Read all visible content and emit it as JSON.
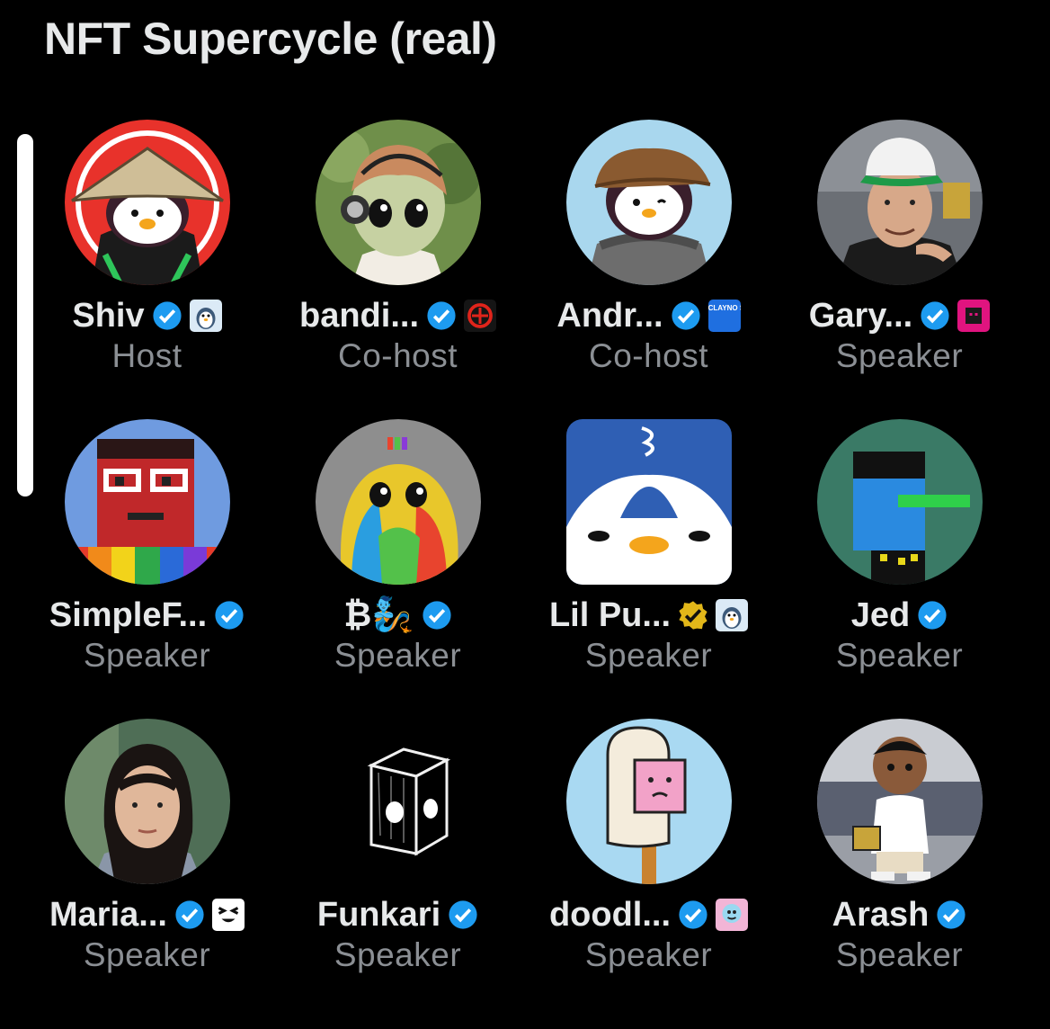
{
  "space": {
    "title": "NFT Supercycle (real)"
  },
  "participants": [
    {
      "name": "Shiv",
      "role": "Host",
      "verified": "blue",
      "affiliation": "pudgy-penguin-badge"
    },
    {
      "name": "bandi...",
      "role": "Co-host",
      "verified": "blue",
      "affiliation": "red-emblem-badge"
    },
    {
      "name": "Andr...",
      "role": "Co-host",
      "verified": "blue",
      "affiliation": "claynosaurz-badge",
      "affiliation_text": "CLAYNO SAURZ"
    },
    {
      "name": "Gary...",
      "role": "Speaker",
      "verified": "blue",
      "affiliation": "magenta-cube-badge"
    },
    {
      "name": "SimpleF...",
      "role": "Speaker",
      "verified": "blue"
    },
    {
      "name": "₿🧞",
      "role": "Speaker",
      "verified": "blue"
    },
    {
      "name": "Lil Pu...",
      "role": "Speaker",
      "verified": "gold",
      "affiliation": "pudgy-penguin-badge"
    },
    {
      "name": "Jed",
      "role": "Speaker",
      "verified": "blue"
    },
    {
      "name": "Maria...",
      "role": "Speaker",
      "verified": "blue",
      "affiliation": "squint-face-badge"
    },
    {
      "name": "Funkari",
      "role": "Speaker",
      "verified": "blue"
    },
    {
      "name": "doodl...",
      "role": "Speaker",
      "verified": "blue",
      "affiliation": "doodles-badge"
    },
    {
      "name": "Arash",
      "role": "Speaker",
      "verified": "blue"
    }
  ],
  "colors": {
    "background": "#000000",
    "title": "#e7e9ea",
    "name": "#e7e9ea",
    "role": "#8b8f94",
    "verified_blue": "#1d9bf0",
    "verified_gold": "#e2b719",
    "scrollbar": "#ffffff"
  }
}
